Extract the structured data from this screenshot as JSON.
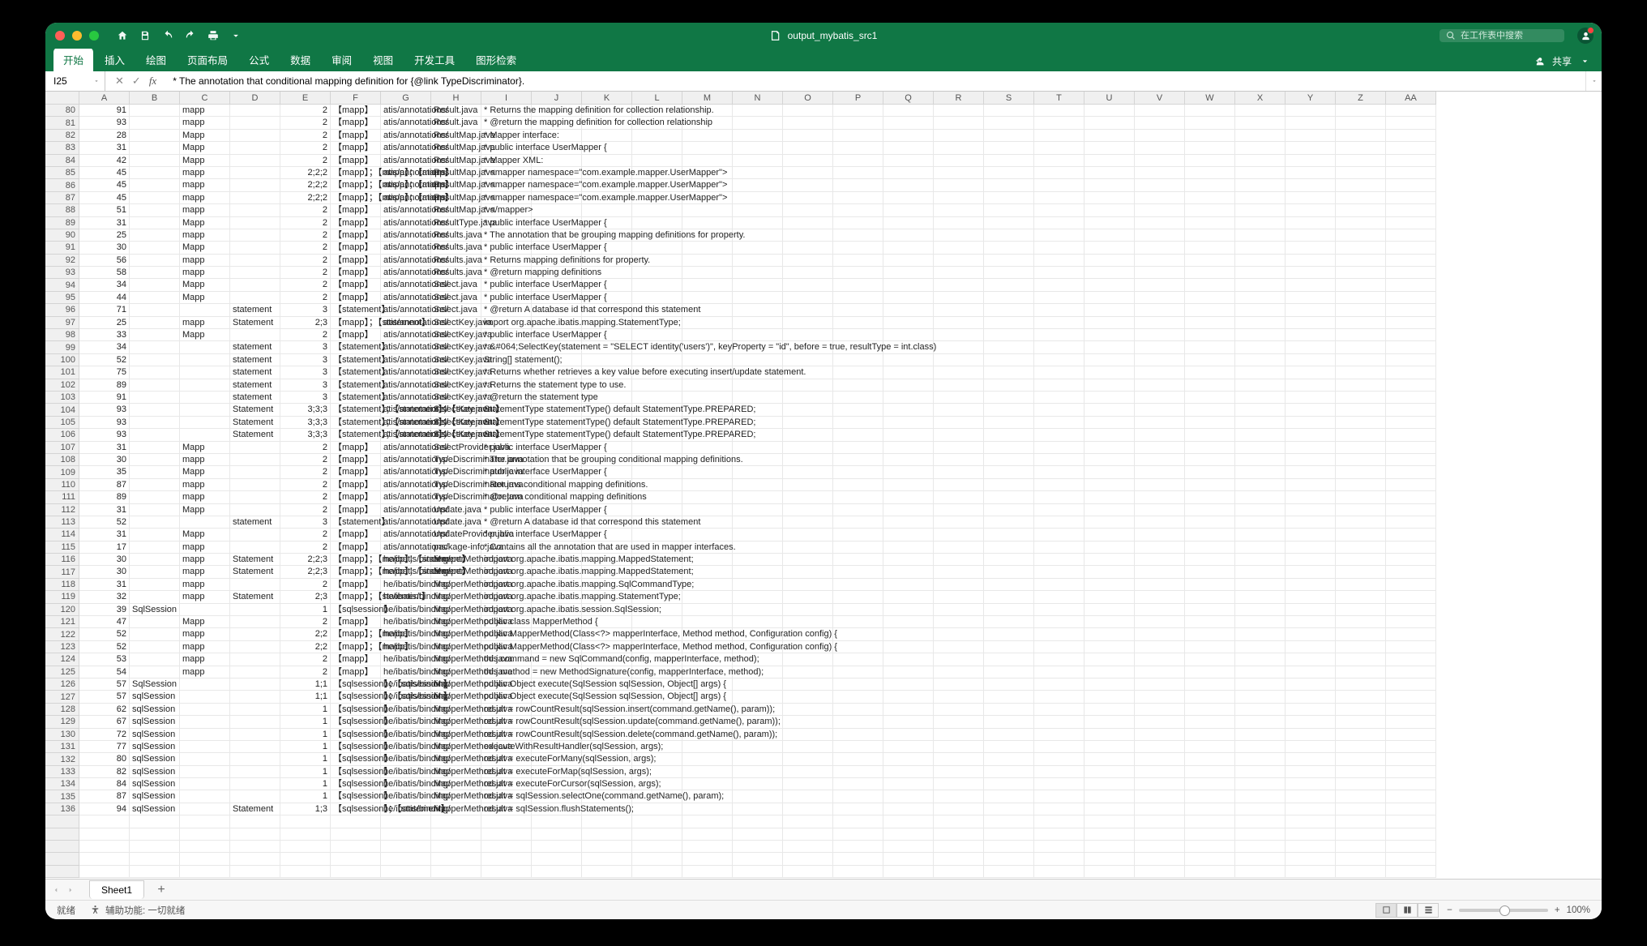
{
  "title": "output_mybatis_src1",
  "search_placeholder": "在工作表中搜索",
  "tabs": [
    "开始",
    "插入",
    "绘图",
    "页面布局",
    "公式",
    "数据",
    "审阅",
    "视图",
    "开发工具",
    "图形检索"
  ],
  "share_label": "共享",
  "namebox": "I25",
  "formula": "   * The annotation that conditional mapping definition for {@link TypeDiscriminator}.",
  "cols": [
    "A",
    "B",
    "C",
    "D",
    "E",
    "F",
    "G",
    "H",
    "I",
    "J",
    "K",
    "L",
    "M",
    "N",
    "O",
    "P",
    "Q",
    "R",
    "S",
    "T",
    "U",
    "V",
    "W",
    "X",
    "Y",
    "Z",
    "AA"
  ],
  "status_ready": "就绪",
  "status_access": "辅助功能: 一切就绪",
  "zoom": "100%",
  "sheet_name": "Sheet1",
  "rows": [
    {
      "n": 80,
      "A": 91,
      "C": "mapp",
      "E": 2,
      "F": "【mapp】",
      "G": "atis/annotations/",
      "H": "Result.java",
      "I": "   * Returns the mapping definition for collection relationship."
    },
    {
      "n": 81,
      "A": 93,
      "C": "mapp",
      "E": 2,
      "F": "【mapp】",
      "G": "atis/annotations/",
      "H": "Result.java",
      "I": "   * @return the mapping definition for collection relationship"
    },
    {
      "n": 82,
      "A": 28,
      "C": "Mapp",
      "E": 2,
      "F": "【mapp】",
      "G": "atis/annotations/",
      "H": "ResultMap.java",
      "I": " * Mapper interface:"
    },
    {
      "n": 83,
      "A": 31,
      "C": "Mapp",
      "E": 2,
      "F": "【mapp】",
      "G": "atis/annotations/",
      "H": "ResultMap.java",
      "I": " * public interface UserMapper {"
    },
    {
      "n": 84,
      "A": 42,
      "C": "Mapp",
      "E": 2,
      "F": "【mapp】",
      "G": "atis/annotations/",
      "H": "ResultMap.java",
      "I": " * Mapper XML:"
    },
    {
      "n": 85,
      "A": 45,
      "C": "mapp",
      "E": "2;2;2",
      "F": "【mapp】；【mapp】；【mapp】",
      "G": "atis/annotations/",
      "H": "ResultMap.java",
      "I": " * <mapper namespace=\"com.example.mapper.UserMapper\">"
    },
    {
      "n": 86,
      "A": 45,
      "C": "mapp",
      "E": "2;2;2",
      "F": "【mapp】；【mapp】；【mapp】",
      "G": "atis/annotations/",
      "H": "ResultMap.java",
      "I": " * <mapper namespace=\"com.example.mapper.UserMapper\">"
    },
    {
      "n": 87,
      "A": 45,
      "C": "mapp",
      "E": "2;2;2",
      "F": "【mapp】；【mapp】；【mapp】",
      "G": "atis/annotations/",
      "H": "ResultMap.java",
      "I": " * <mapper namespace=\"com.example.mapper.UserMapper\">"
    },
    {
      "n": 88,
      "A": 51,
      "C": "mapp",
      "E": 2,
      "F": "【mapp】",
      "G": "atis/annotations/",
      "H": "ResultMap.java",
      "I": " * </mapper>"
    },
    {
      "n": 89,
      "A": 31,
      "C": "Mapp",
      "E": 2,
      "F": "【mapp】",
      "G": "atis/annotations/",
      "H": "ResultType.java",
      "I": " * public interface UserMapper {"
    },
    {
      "n": 90,
      "A": 25,
      "C": "mapp",
      "E": 2,
      "F": "【mapp】",
      "G": "atis/annotations/",
      "H": "Results.java",
      "I": " * The annotation that be grouping mapping definitions for property."
    },
    {
      "n": 91,
      "A": 30,
      "C": "Mapp",
      "E": 2,
      "F": "【mapp】",
      "G": "atis/annotations/",
      "H": "Results.java",
      "I": " * public interface UserMapper {"
    },
    {
      "n": 92,
      "A": 56,
      "C": "mapp",
      "E": 2,
      "F": "【mapp】",
      "G": "atis/annotations/",
      "H": "Results.java",
      "I": "   * Returns mapping definitions for property."
    },
    {
      "n": 93,
      "A": 58,
      "C": "mapp",
      "E": 2,
      "F": "【mapp】",
      "G": "atis/annotations/",
      "H": "Results.java",
      "I": "   * @return mapping definitions"
    },
    {
      "n": 94,
      "A": 34,
      "C": "Mapp",
      "E": 2,
      "F": "【mapp】",
      "G": "atis/annotations/",
      "H": "Select.java",
      "I": " * public interface UserMapper {"
    },
    {
      "n": 95,
      "A": 44,
      "C": "Mapp",
      "E": 2,
      "F": "【mapp】",
      "G": "atis/annotations/",
      "H": "Select.java",
      "I": " * public interface UserMapper {"
    },
    {
      "n": 96,
      "A": 71,
      "D": "statement",
      "E": 3,
      "F": "【statement】",
      "G": "atis/annotations/",
      "H": "Select.java",
      "I": "   * @return A database id that correspond this statement"
    },
    {
      "n": 97,
      "A": 25,
      "C": "mapp",
      "D": "Statement",
      "E": "2;3",
      "F": "【mapp】；【statement】",
      "G": "atis/annotations/",
      "H": "SelectKey.java",
      "I": "import org.apache.ibatis.mapping.StatementType;"
    },
    {
      "n": 98,
      "A": 33,
      "C": "Mapp",
      "E": 2,
      "F": "【mapp】",
      "G": "atis/annotations/",
      "H": "SelectKey.java",
      "I": " * public interface UserMapper {"
    },
    {
      "n": 99,
      "A": 34,
      "D": "statement",
      "E": 3,
      "F": "【statement】",
      "G": "atis/annotations/",
      "H": "SelectKey.java",
      "I": " *   &#064;SelectKey(statement = \"SELECT identity('users')\", keyProperty = \"id\", before = true, resultType = int.class)"
    },
    {
      "n": 100,
      "A": 52,
      "D": "statement",
      "E": 3,
      "F": "【statement】",
      "G": "atis/annotations/",
      "H": "SelectKey.java",
      "I": "  String[] statement();"
    },
    {
      "n": 101,
      "A": 75,
      "D": "statement",
      "E": 3,
      "F": "【statement】",
      "G": "atis/annotations/",
      "H": "SelectKey.java",
      "I": "   * Returns whether retrieves a key value before executing insert/update statement."
    },
    {
      "n": 102,
      "A": 89,
      "D": "statement",
      "E": 3,
      "F": "【statement】",
      "G": "atis/annotations/",
      "H": "SelectKey.java",
      "I": "   * Returns the statement type to use."
    },
    {
      "n": 103,
      "A": 91,
      "D": "statement",
      "E": 3,
      "F": "【statement】",
      "G": "atis/annotations/",
      "H": "SelectKey.java",
      "I": "   * @return the statement type"
    },
    {
      "n": 104,
      "A": 93,
      "D": "Statement",
      "E": "3;3;3",
      "F": "【statement】；【statement】；【statement】",
      "G": "atis/annotations/",
      "H": "SelectKey.java",
      "I": "  StatementType statementType() default StatementType.PREPARED;"
    },
    {
      "n": 105,
      "A": 93,
      "D": "Statement",
      "E": "3;3;3",
      "F": "【statement】；【statement】；【statement】",
      "G": "atis/annotations/",
      "H": "SelectKey.java",
      "I": "  StatementType statementType() default StatementType.PREPARED;"
    },
    {
      "n": 106,
      "A": 93,
      "D": "Statement",
      "E": "3;3;3",
      "F": "【statement】；【statement】；【statement】",
      "G": "atis/annotations/",
      "H": "SelectKey.java",
      "I": "  StatementType statementType() default StatementType.PREPARED;"
    },
    {
      "n": 107,
      "A": 31,
      "C": "Mapp",
      "E": 2,
      "F": "【mapp】",
      "G": "atis/annotations/",
      "H": "SelectProvider.java",
      "I": " * public interface UserMapper {"
    },
    {
      "n": 108,
      "A": 30,
      "C": "mapp",
      "E": 2,
      "F": "【mapp】",
      "G": "atis/annotations/",
      "H": "TypeDiscriminator.java",
      "I": " * The annotation that be grouping conditional mapping definitions."
    },
    {
      "n": 109,
      "A": 35,
      "C": "Mapp",
      "E": 2,
      "F": "【mapp】",
      "G": "atis/annotations/",
      "H": "TypeDiscriminator.java",
      "I": " * public interface UserMapper {"
    },
    {
      "n": 110,
      "A": 87,
      "C": "mapp",
      "E": 2,
      "F": "【mapp】",
      "G": "atis/annotations/",
      "H": "TypeDiscriminator.java",
      "I": "   * Returns conditional mapping definitions."
    },
    {
      "n": 111,
      "A": 89,
      "C": "mapp",
      "E": 2,
      "F": "【mapp】",
      "G": "atis/annotations/",
      "H": "TypeDiscriminator.java",
      "I": "   * @return conditional mapping definitions"
    },
    {
      "n": 112,
      "A": 31,
      "C": "Mapp",
      "E": 2,
      "F": "【mapp】",
      "G": "atis/annotations/",
      "H": "Update.java",
      "I": " * public interface UserMapper {"
    },
    {
      "n": 113,
      "A": 52,
      "D": "statement",
      "E": 3,
      "F": "【statement】",
      "G": "atis/annotations/",
      "H": "Update.java",
      "I": "   * @return A database id that correspond this statement"
    },
    {
      "n": 114,
      "A": 31,
      "C": "Mapp",
      "E": 2,
      "F": "【mapp】",
      "G": "atis/annotations/",
      "H": "UpdateProvider.java",
      "I": " * public interface UserMapper {"
    },
    {
      "n": 115,
      "A": 17,
      "C": "mapp",
      "E": 2,
      "F": "【mapp】",
      "G": "atis/annotations/",
      "H": "package-info.java",
      "I": " * Contains all the annotation that are used in mapper interfaces."
    },
    {
      "n": 116,
      "A": 30,
      "C": "mapp",
      "D": "Statement",
      "E": "2;2;3",
      "F": "【mapp】；【mapp】；【statement】",
      "G": "he/ibatis/binding/",
      "H": "MapperMethod.java",
      "I": "import org.apache.ibatis.mapping.MappedStatement;"
    },
    {
      "n": 117,
      "A": 30,
      "C": "mapp",
      "D": "Statement",
      "E": "2;2;3",
      "F": "【mapp】；【mapp】；【statement】",
      "G": "he/ibatis/binding/",
      "H": "MapperMethod.java",
      "I": "import org.apache.ibatis.mapping.MappedStatement;"
    },
    {
      "n": 118,
      "A": 31,
      "C": "mapp",
      "E": 2,
      "F": "【mapp】",
      "G": "he/ibatis/binding/",
      "H": "MapperMethod.java",
      "I": "import org.apache.ibatis.mapping.SqlCommandType;"
    },
    {
      "n": 119,
      "A": 32,
      "C": "mapp",
      "D": "Statement",
      "E": "2;3",
      "F": "【mapp】；【statement】",
      "G": "he/ibatis/binding/",
      "H": "MapperMethod.java",
      "I": "import org.apache.ibatis.mapping.StatementType;"
    },
    {
      "n": 120,
      "A": 39,
      "B": "SqlSession",
      "E": 1,
      "F": "【sqlsession】",
      "G": "he/ibatis/binding/",
      "H": "MapperMethod.java",
      "I": "import org.apache.ibatis.session.SqlSession;"
    },
    {
      "n": 121,
      "A": 47,
      "C": "Mapp",
      "E": 2,
      "F": "【mapp】",
      "G": "he/ibatis/binding/",
      "H": "MapperMethod.java",
      "I": "public class MapperMethod {"
    },
    {
      "n": 122,
      "A": 52,
      "C": "mapp",
      "E": "2;2",
      "F": "【mapp】；【mapp】",
      "G": "he/ibatis/binding/",
      "H": "MapperMethod.java",
      "I": "  public MapperMethod(Class<?> mapperInterface, Method method, Configuration config) {"
    },
    {
      "n": 123,
      "A": 52,
      "C": "mapp",
      "E": "2;2",
      "F": "【mapp】；【mapp】",
      "G": "he/ibatis/binding/",
      "H": "MapperMethod.java",
      "I": "  public MapperMethod(Class<?> mapperInterface, Method method, Configuration config) {"
    },
    {
      "n": 124,
      "A": 53,
      "C": "mapp",
      "E": 2,
      "F": "【mapp】",
      "G": "he/ibatis/binding/",
      "H": "MapperMethod.java",
      "I": "    this.command = new SqlCommand(config, mapperInterface, method);"
    },
    {
      "n": 125,
      "A": 54,
      "C": "mapp",
      "E": 2,
      "F": "【mapp】",
      "G": "he/ibatis/binding/",
      "H": "MapperMethod.java",
      "I": "    this.method = new MethodSignature(config, mapperInterface, method);"
    },
    {
      "n": 126,
      "A": 57,
      "B": "SqlSession",
      "E": "1;1",
      "F": "【sqlsession】；【sqlsession】",
      "G": "he/ibatis/binding/",
      "H": "MapperMethod.java",
      "I": "  public Object execute(SqlSession sqlSession, Object[] args) {"
    },
    {
      "n": 127,
      "A": 57,
      "B": "sqlSession",
      "E": "1;1",
      "F": "【sqlsession】；【sqlsession】",
      "G": "he/ibatis/binding/",
      "H": "MapperMethod.java",
      "I": "  public Object execute(SqlSession sqlSession, Object[] args) {"
    },
    {
      "n": 128,
      "A": 62,
      "B": "sqlSession",
      "E": 1,
      "F": "【sqlsession】",
      "G": "he/ibatis/binding/",
      "H": "MapperMethod.java",
      "I": "        result = rowCountResult(sqlSession.insert(command.getName(), param));"
    },
    {
      "n": 129,
      "A": 67,
      "B": "sqlSession",
      "E": 1,
      "F": "【sqlsession】",
      "G": "he/ibatis/binding/",
      "H": "MapperMethod.java",
      "I": "        result = rowCountResult(sqlSession.update(command.getName(), param));"
    },
    {
      "n": 130,
      "A": 72,
      "B": "sqlSession",
      "E": 1,
      "F": "【sqlsession】",
      "G": "he/ibatis/binding/",
      "H": "MapperMethod.java",
      "I": "        result = rowCountResult(sqlSession.delete(command.getName(), param));"
    },
    {
      "n": 131,
      "A": 77,
      "B": "sqlSession",
      "E": 1,
      "F": "【sqlsession】",
      "G": "he/ibatis/binding/",
      "H": "MapperMethod.java",
      "I": "          executeWithResultHandler(sqlSession, args);"
    },
    {
      "n": 132,
      "A": 80,
      "B": "sqlSession",
      "E": 1,
      "F": "【sqlsession】",
      "G": "he/ibatis/binding/",
      "H": "MapperMethod.java",
      "I": "          result = executeForMany(sqlSession, args);"
    },
    {
      "n": 133,
      "A": 82,
      "B": "sqlSession",
      "E": 1,
      "F": "【sqlsession】",
      "G": "he/ibatis/binding/",
      "H": "MapperMethod.java",
      "I": "          result = executeForMap(sqlSession, args);"
    },
    {
      "n": 134,
      "A": 84,
      "B": "sqlSession",
      "E": 1,
      "F": "【sqlsession】",
      "G": "he/ibatis/binding/",
      "H": "MapperMethod.java",
      "I": "          result = executeForCursor(sqlSession, args);"
    },
    {
      "n": 135,
      "A": 87,
      "B": "sqlSession",
      "E": 1,
      "F": "【sqlsession】",
      "G": "he/ibatis/binding/",
      "H": "MapperMethod.java",
      "I": "          result = sqlSession.selectOne(command.getName(), param);"
    },
    {
      "n": 136,
      "A": 94,
      "B": "sqlSession",
      "D": "Statement",
      "E": "1;3",
      "F": "【sqlsession】；【statement】",
      "G": "he/ibatis/binding/",
      "H": "MapperMethod.java",
      "I": "        result = sqlSession.flushStatements();"
    }
  ]
}
